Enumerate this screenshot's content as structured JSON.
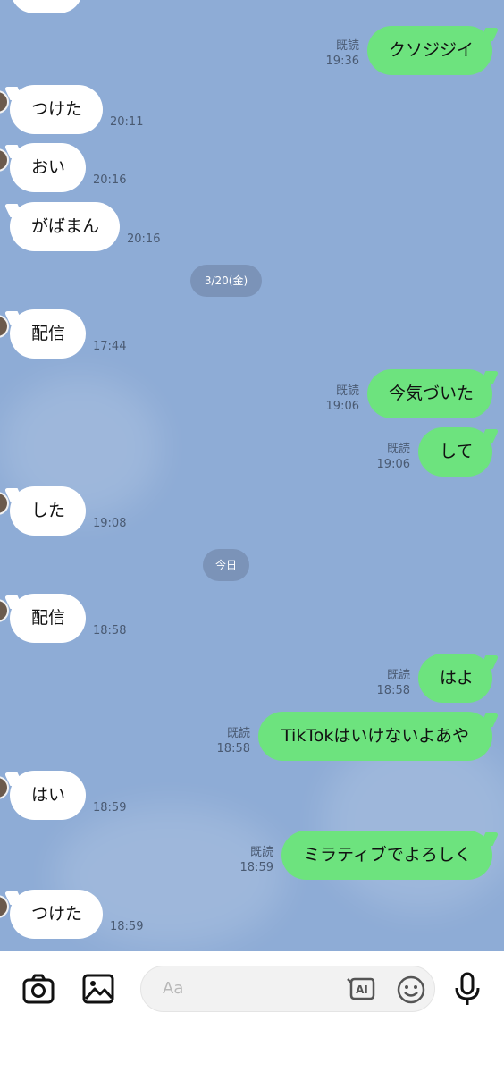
{
  "input": {
    "placeholder": "Aa"
  },
  "dates": {
    "d1": "3/20(金)",
    "d2": "今日"
  },
  "messages": {
    "m0": {
      "text": "クソジジイ",
      "time": "19:36",
      "read": "既読"
    },
    "m1": {
      "text": "つけた",
      "time": "20:11"
    },
    "m2": {
      "text": "おい",
      "time": "20:16"
    },
    "m3": {
      "text": "がばまん",
      "time": "20:16"
    },
    "m4": {
      "text": "配信",
      "time": "17:44"
    },
    "m5": {
      "text": "今気づいた",
      "time": "19:06",
      "read": "既読"
    },
    "m6": {
      "text": "して",
      "time": "19:06",
      "read": "既読"
    },
    "m7": {
      "text": "した",
      "time": "19:08"
    },
    "m8": {
      "text": "配信",
      "time": "18:58"
    },
    "m9": {
      "text": "はよ",
      "time": "18:58",
      "read": "既読"
    },
    "m10": {
      "text": "TikTokはいけないよあや",
      "time": "18:58",
      "read": "既読"
    },
    "m11": {
      "text": "はい",
      "time": "18:59"
    },
    "m12": {
      "text": "ミラティブでよろしく",
      "time": "18:59",
      "read": "既読"
    },
    "m13": {
      "text": "つけた",
      "time": "18:59"
    }
  },
  "icons": [
    "camera-icon",
    "image-icon",
    "ai-icon",
    "emoji-icon",
    "microphone-icon"
  ],
  "colors": {
    "chat_bg": "#8eacd6",
    "sent_bubble": "#6de37e",
    "received_bubble": "#ffffff"
  }
}
